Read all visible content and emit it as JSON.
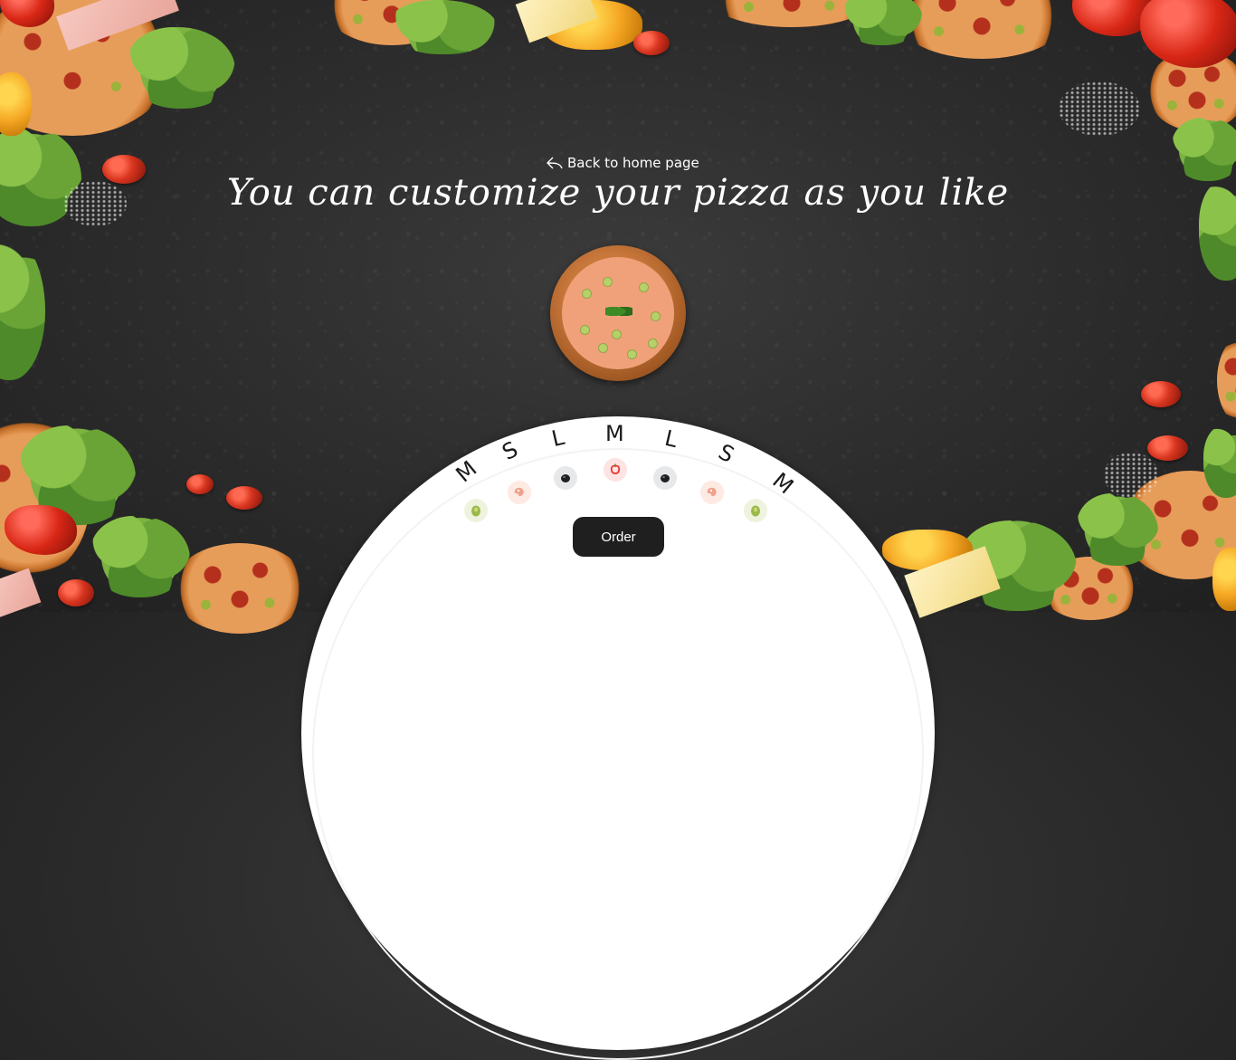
{
  "nav": {
    "back_label": "Back to home page",
    "back_icon": "reply-arrow-icon"
  },
  "headline": "You can customize your pizza as you like",
  "pizza_preview": {
    "icon": "pizza-image"
  },
  "size_selector": {
    "letters": [
      "M",
      "S",
      "L",
      "M",
      "L",
      "S",
      "M"
    ]
  },
  "ingredients": [
    {
      "name": "olive-green",
      "icon": "green-olive-icon",
      "bg": "#eef3dd"
    },
    {
      "name": "ham",
      "icon": "ham-icon",
      "bg": "#fdeae3"
    },
    {
      "name": "olive-black",
      "icon": "black-olive-icon",
      "bg": "#e6e8ea"
    },
    {
      "name": "pepper",
      "icon": "red-pepper-icon",
      "bg": "#fde3e3"
    },
    {
      "name": "olive-black",
      "icon": "black-olive-icon",
      "bg": "#e6e8ea"
    },
    {
      "name": "ham",
      "icon": "ham-icon",
      "bg": "#fdeae3"
    },
    {
      "name": "olive-green",
      "icon": "green-olive-icon",
      "bg": "#eef3dd"
    }
  ],
  "order_button": {
    "label": "Order"
  },
  "colors": {
    "board": "#2e2e2e",
    "dome": "#ffffff",
    "button": "#1f1f1f",
    "text_light": "#ffffff"
  }
}
